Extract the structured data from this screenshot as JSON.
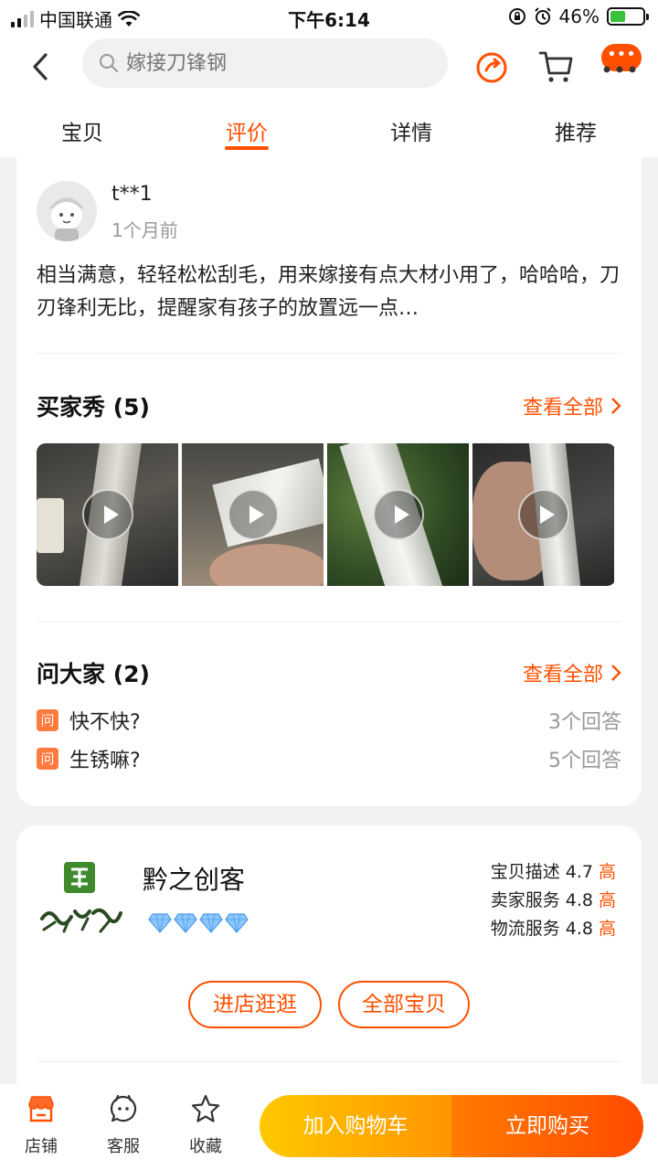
{
  "status": {
    "carrier": "中国联通",
    "time": "下午6:14",
    "battery": "46%",
    "battery_level": 0.46
  },
  "header": {
    "search_placeholder": "嫁接刀锋钢",
    "msg_badge": "•••"
  },
  "tabs": [
    {
      "label": "宝贝",
      "active": false
    },
    {
      "label": "评价",
      "active": true
    },
    {
      "label": "详情",
      "active": false
    },
    {
      "label": "推荐",
      "active": false
    }
  ],
  "review": {
    "user": "t**1",
    "time": "1个月前",
    "text": "相当满意，轻轻松松刮毛，用来嫁接有点大材小用了，哈哈哈，刀刃锋利无比，提醒家有孩子的放置远一点…"
  },
  "buyer_show": {
    "title": "买家秀 (5)",
    "see_all": "查看全部"
  },
  "qa": {
    "title": "问大家 (2)",
    "see_all": "查看全部",
    "badge": "问",
    "items": [
      {
        "question": "快不快?",
        "answers": "3个回答"
      },
      {
        "question": "生锈嘛?",
        "answers": "5个回答"
      }
    ]
  },
  "shop": {
    "name": "黔之创客",
    "scores": [
      {
        "label": "宝贝描述",
        "value": "4.7",
        "level": "高"
      },
      {
        "label": "卖家服务",
        "value": "4.8",
        "level": "高"
      },
      {
        "label": "物流服务",
        "value": "4.8",
        "level": "高"
      }
    ],
    "enter_label": "进店逛逛",
    "all_items_label": "全部宝贝"
  },
  "bottom": {
    "shop_label": "店铺",
    "service_label": "客服",
    "fav_label": "收藏",
    "add_cart_label": "加入购物车",
    "buy_now_label": "立即购买"
  },
  "colors": {
    "accent": "#ff5000",
    "cart_gradient": [
      "#ffc800",
      "#ff9500"
    ],
    "buy_gradient": [
      "#ff7b00",
      "#ff4b00"
    ]
  }
}
